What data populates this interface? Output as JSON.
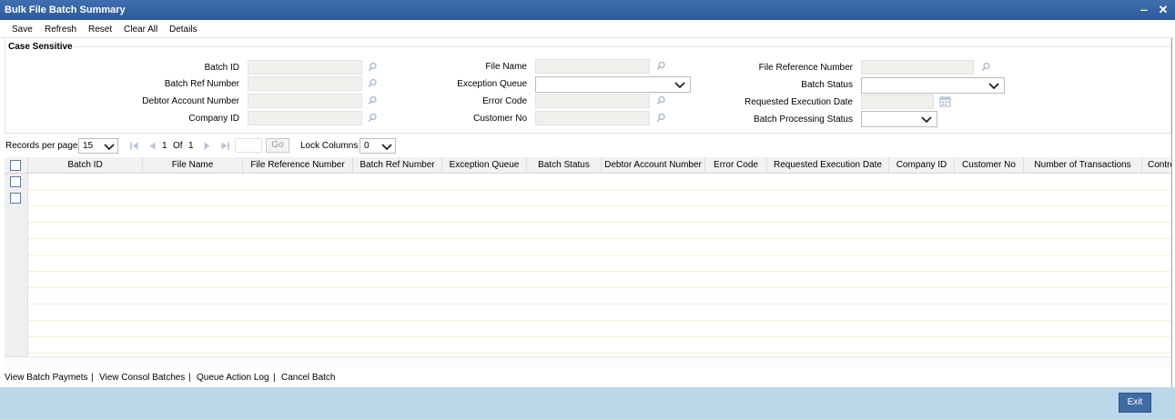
{
  "window": {
    "title": "Bulk File Batch Summary",
    "minimize": "‒",
    "close": "✕"
  },
  "toolbar": {
    "save": "Save",
    "refresh": "Refresh",
    "reset": "Reset",
    "clear_all": "Clear All",
    "details": "Details"
  },
  "section": {
    "title": "Case Sensitive"
  },
  "fields": {
    "batch_id": {
      "label": "Batch ID",
      "value": ""
    },
    "batch_ref_number": {
      "label": "Batch Ref Number",
      "value": ""
    },
    "debtor_account_number": {
      "label": "Debtor Account Number",
      "value": ""
    },
    "company_id": {
      "label": "Company ID",
      "value": ""
    },
    "file_name": {
      "label": "File Name",
      "value": ""
    },
    "exception_queue": {
      "label": "Exception Queue",
      "value": ""
    },
    "error_code": {
      "label": "Error Code",
      "value": ""
    },
    "customer_no": {
      "label": "Customer No",
      "value": ""
    },
    "file_reference_number": {
      "label": "File Reference Number",
      "value": ""
    },
    "batch_status": {
      "label": "Batch Status",
      "value": ""
    },
    "requested_execution_date": {
      "label": "Requested Execution Date",
      "value": ""
    },
    "batch_processing_status": {
      "label": "Batch Processing Status",
      "value": ""
    }
  },
  "pager": {
    "records_per_page_label": "Records per page",
    "records_per_page": "15",
    "current_page": "1",
    "of_label": "Of",
    "total_pages": "1",
    "go": "Go",
    "lock_columns_label": "Lock Columns",
    "lock_columns": "0"
  },
  "grid": {
    "columns": [
      "Batch ID",
      "File Name",
      "File Reference Number",
      "Batch Ref Number",
      "Exception Queue",
      "Batch Status",
      "Debtor Account Number",
      "Error Code",
      "Requested Execution Date",
      "Company ID",
      "Customer No",
      "Number of Transactions",
      "Contro"
    ]
  },
  "links": {
    "view_batch_payments": "View Batch Paymets",
    "view_consol_batches": "View Consol Batches",
    "queue_action_log": "Queue Action Log",
    "cancel_batch": "Cancel Batch",
    "separator": "|"
  },
  "footer": {
    "exit": "Exit"
  },
  "colors": {
    "title_bar": "#2d5a9a",
    "footer": "#bcd6ea",
    "exit_button": "#3e6da5",
    "input_bg": "#f1f0ec"
  },
  "icons": {
    "lookup": "magnifier-icon",
    "dropdown": "chevron-down-icon",
    "calendar": "calendar-icon",
    "pager_nav": "first-prev-next-last-icons"
  }
}
